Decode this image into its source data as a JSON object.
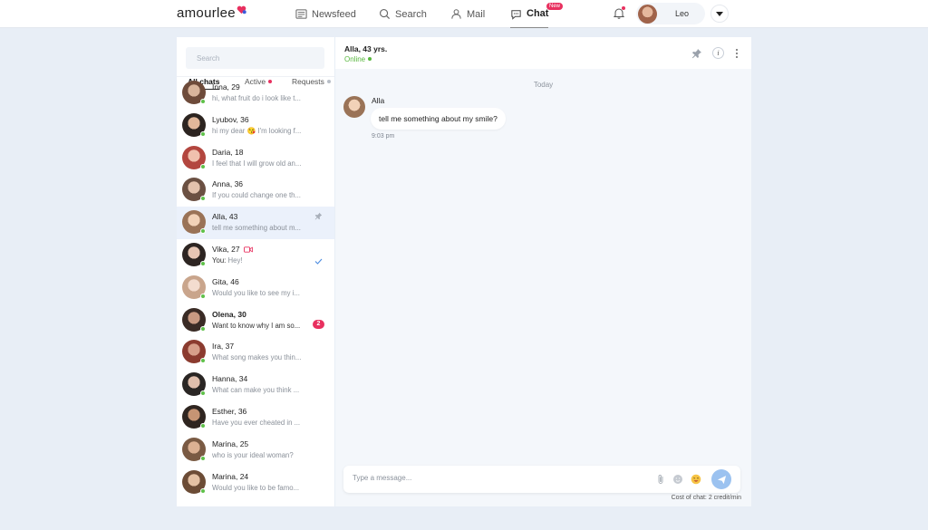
{
  "header": {
    "logo": "amourlee",
    "nav": [
      {
        "label": "Newsfeed"
      },
      {
        "label": "Search"
      },
      {
        "label": "Mail"
      },
      {
        "label": "Chat",
        "badge": "New"
      }
    ],
    "user_name": "Leo"
  },
  "sidebar": {
    "search_placeholder": "Search",
    "tabs": [
      "All chats",
      "Active",
      "Requests"
    ],
    "chats": [
      {
        "name": "Inna, 29",
        "preview": "hi, what fruit do i look like t...",
        "colors": [
          "#d9b59c",
          "#6e4b3a"
        ]
      },
      {
        "name": "Lyubov, 36",
        "preview": "hi my dear 😘 I'm looking f...",
        "colors": [
          "#e1b79a",
          "#2c2420"
        ]
      },
      {
        "name": "Daria, 18",
        "preview": "I feel that I will grow old an...",
        "colors": [
          "#f0c0ae",
          "#b3463f"
        ]
      },
      {
        "name": "Anna, 36",
        "preview": "If you could change one th...",
        "colors": [
          "#e3c2ad",
          "#6b5042"
        ]
      },
      {
        "name": "Alla, 43",
        "preview": "tell me something about m...",
        "colors": [
          "#f2d2b8",
          "#9a7357"
        ],
        "selected": true,
        "pinned": true
      },
      {
        "name": "Vika, 27",
        "preview_prefix": "You:",
        "preview": "Hey!",
        "colors": [
          "#e7c6b4",
          "#2d2522"
        ],
        "video": true,
        "read": true
      },
      {
        "name": "Gita, 46",
        "preview": "Would you like to see my i...",
        "colors": [
          "#f3dccf",
          "#c9a58c"
        ]
      },
      {
        "name": "Olena, 30",
        "preview": "Want to know why I am so...",
        "colors": [
          "#c99a82",
          "#3a2b25"
        ],
        "unread": "2"
      },
      {
        "name": "Ira, 37",
        "preview": "What song makes you thin...",
        "colors": [
          "#d79f8a",
          "#8b3b2f"
        ]
      },
      {
        "name": "Hanna, 34",
        "preview": "What can make you think ...",
        "colors": [
          "#e0bfad",
          "#2a2624"
        ]
      },
      {
        "name": "Esther, 36",
        "preview": "Have you ever cheated in ...",
        "colors": [
          "#c69474",
          "#2f2520"
        ]
      },
      {
        "name": "Marina, 25",
        "preview": "who is your ideal woman?",
        "colors": [
          "#dcb193",
          "#7a5a43"
        ]
      },
      {
        "name": "Marina, 24",
        "preview": "Would you like to be famo...",
        "colors": [
          "#e4c1a4",
          "#6c4c36"
        ]
      },
      {
        "name": "",
        "preview": "",
        "colors": [
          "#e0bfa8",
          "#7a5a48"
        ]
      }
    ]
  },
  "chat": {
    "title": "Alla, 43 yrs.",
    "status": "Online",
    "date_separator": "Today",
    "messages": [
      {
        "sender": "Alla",
        "text": "tell me something about my smile?",
        "time": "9:03 pm"
      }
    ],
    "composer_placeholder": "Type a message...",
    "cost_text": "Cost of chat: 2 credit/min"
  },
  "colors": {
    "accent": "#e8305f",
    "online": "#5fc14a",
    "send": "#9bc2f0",
    "selected_row": "#ebf1fb"
  }
}
